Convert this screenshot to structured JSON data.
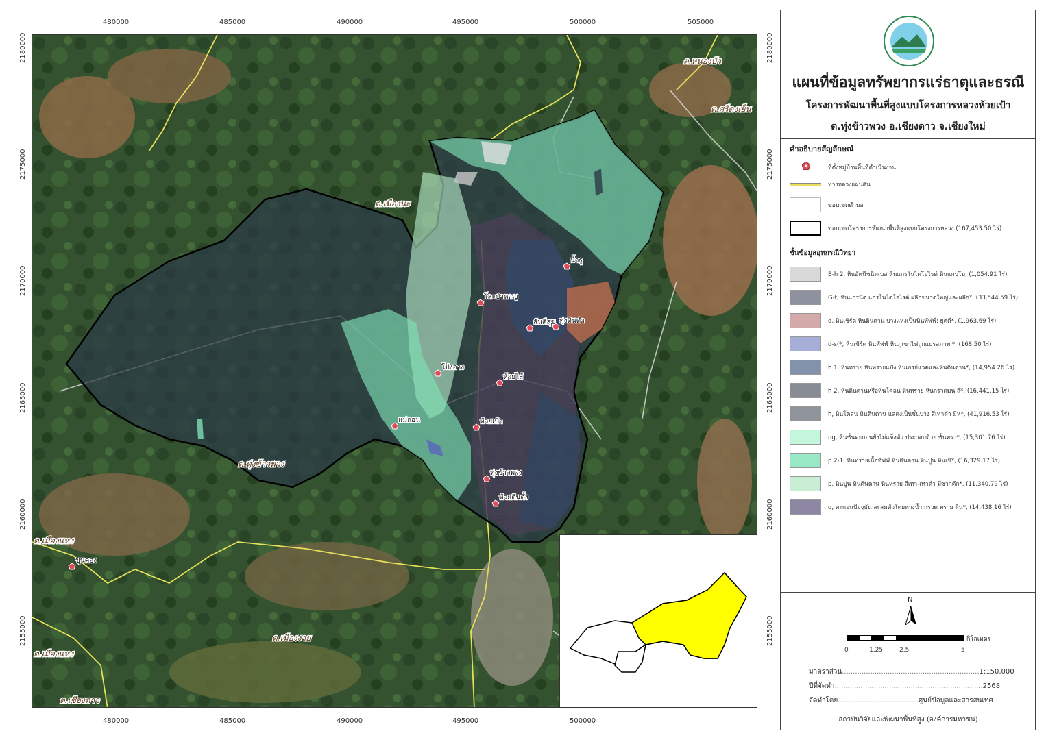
{
  "map": {
    "x_ticks": [
      "480000",
      "485000",
      "490000",
      "495000",
      "500000",
      "505000"
    ],
    "y_ticks": [
      "2180000",
      "2175000",
      "2170000",
      "2165000",
      "2160000",
      "2155000"
    ],
    "tambon_labels": [
      {
        "name": "ต.หนองบัว"
      },
      {
        "name": "ต.ศรีดงเย็น"
      },
      {
        "name": "ต.เมืองนะ"
      },
      {
        "name": "ต.ทุ่งข้าวพวง"
      },
      {
        "name": "ต.เมืองแหง"
      },
      {
        "name": "ต.เมืองแหง"
      },
      {
        "name": "ต.เมืองงาย"
      },
      {
        "name": "ต.เชียงดาว"
      }
    ],
    "villages": [
      "น้ำรู",
      "โละป่าหาญ",
      "ลันคีสุข",
      "ทุ่งดินดำ",
      "โป่งอาง",
      "ห้วยไส้",
      "แม่กอน",
      "ห้วยเป๋า",
      "ทุ่งข้าวพวง",
      "ห้วยตีนตั้ง",
      "ขุนคอง"
    ]
  },
  "header": {
    "title": "แผนที่ข้อมูลทรัพยากรแร่ธาตุและธรณี",
    "subtitle": "โครงการพัฒนาพื้นที่สูงแบบโครงการหลวงห้วยเป้า",
    "location": "ต.ทุ่งข้าวพวง อ.เชียงดาว จ.เชียงใหม่"
  },
  "legend": {
    "heading": "คำอธิบายสัญลักษณ์",
    "items": [
      {
        "label": "ที่ตั้งหมู่บ้านพื้นที่ดำเนินงาน"
      },
      {
        "label": "ทางหลวงแผ่นดิน"
      },
      {
        "label": "ขอบเขตตำบล"
      },
      {
        "label": "ขอบเขตโครงการพัฒนาพื้นที่สูงแบบโครงการหลวง (167,453.50 ไร่)"
      }
    ],
    "geo_heading": "ชั้นข้อมูลอุทกรณีวิทยา",
    "geo_items": [
      {
        "label": "B-h 2,  หินอัคนีชนิดเบส หินแกรโนไดโอไรต์ หินแกบโบ, (1,054.91 ไร่)",
        "color": "#d9d9d9"
      },
      {
        "label": "G-t,  หินแกรนิต แกรโนไดโอไรต์ ผลึกขนาดใหญ่และผลึก*, (33,544.59 ไร่)",
        "color": "#8e929e"
      },
      {
        "label": "d,  หินเชิร์ต หินดินดาน บางแห่งเป็นหินทัฟฟ์; ยุคดี*, (1,963.69 ไร่)",
        "color": "#d4a9a9"
      },
      {
        "label": "d-s(*,  หินเชิร์ต หินทัฟฟ์ หินภูเขาไฟถูกแปรสภาพ *, (168.50 ไร่)",
        "color": "#a7add9"
      },
      {
        "label": "h 1,  หินทราย หินทรายแป้ง หินเกรย์แวคและหินดินดาน*, (14,954.26 ไร่)",
        "color": "#8292aa"
      },
      {
        "label": "h 2,   หินดินดานหรือหินโคลน หินทราย หินกรวดมน สี*, (16,441.15 ไร่)",
        "color": "#888d95"
      },
      {
        "label": "h,  หินโคลน หินดินดาน แสดงเป็นชั้นบาง สีเทาดำ มีห*, (41,916.53 ไร่)",
        "color": "#8f939a"
      },
      {
        "label": "ng,  หินชั้นตะกอนยังไม่แข็งตัว ประกอบด้วย ชั้นทรา*, (15,301.76 ไร่)",
        "color": "#c3f6db"
      },
      {
        "label": "p 2-1,  หินทรายเนื้อทัฟฟ์ หินดินดาน หินปูน หินเชิ*, (16,329.17 ไร่)",
        "color": "#98e8c5"
      },
      {
        "label": "p,  หินปูน หินดินดาน หินทราย สีเทา-เทาดำ มีซากดึก*, (11,340.79 ไร่)",
        "color": "#c8eed6"
      },
      {
        "label": "q,  ตะกอนปัจจุบัน สะสมตัวโดยทางน้ำ กรวด  ทราย ดิน*, (14,438.16 ไร่)",
        "color": "#8d87a3"
      }
    ]
  },
  "scalebar": {
    "north": "N",
    "ticks": [
      "0",
      "1.25",
      "2.5",
      "5"
    ],
    "unit": "กิโลเมตร"
  },
  "info": {
    "scale_label": "มาตราส่วน",
    "scale_value": "1:150,000",
    "year_label": "ปีที่จัดทำ",
    "year_value": "2568",
    "by_label": "จัดทำโดย",
    "by_value": "ศูนย์ข้อมูลและสารสนเทศ",
    "footer": "สถาบันวิจัยและพัฒนาพื้นที่สูง (องค์การมหาชน)"
  },
  "colors": {
    "forest_dark": "#2d4a2e",
    "forest_mid": "#3f6238",
    "road": "#e8e05a",
    "boundary": "#000000",
    "village": "#e14b57",
    "inset_fill": "#ffff00"
  }
}
